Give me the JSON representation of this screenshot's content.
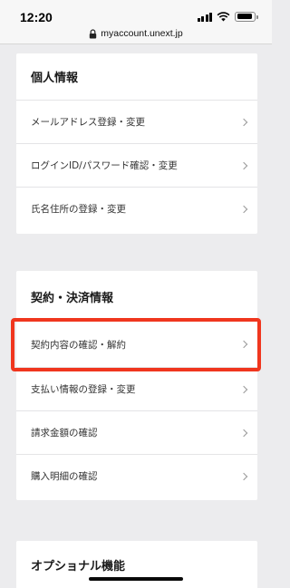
{
  "status_bar": {
    "time": "12:20"
  },
  "browser": {
    "url": "myaccount.unext.jp"
  },
  "sections": {
    "personal": {
      "title": "個人情報",
      "items": [
        "メールアドレス登録・変更",
        "ログインID/パスワード確認・変更",
        "氏名住所の登録・変更"
      ]
    },
    "contract": {
      "title": "契約・決済情報",
      "items": [
        "契約内容の確認・解約",
        "支払い情報の登録・変更",
        "請求金額の確認",
        "購入明細の確認"
      ]
    },
    "options": {
      "title": "オプショナル機能"
    }
  },
  "highlight": {
    "target": "契約内容の確認・解約",
    "color": "#f0361e"
  },
  "colors": {
    "background": "#ececee",
    "card": "#ffffff",
    "divider": "#e4e4e6"
  }
}
